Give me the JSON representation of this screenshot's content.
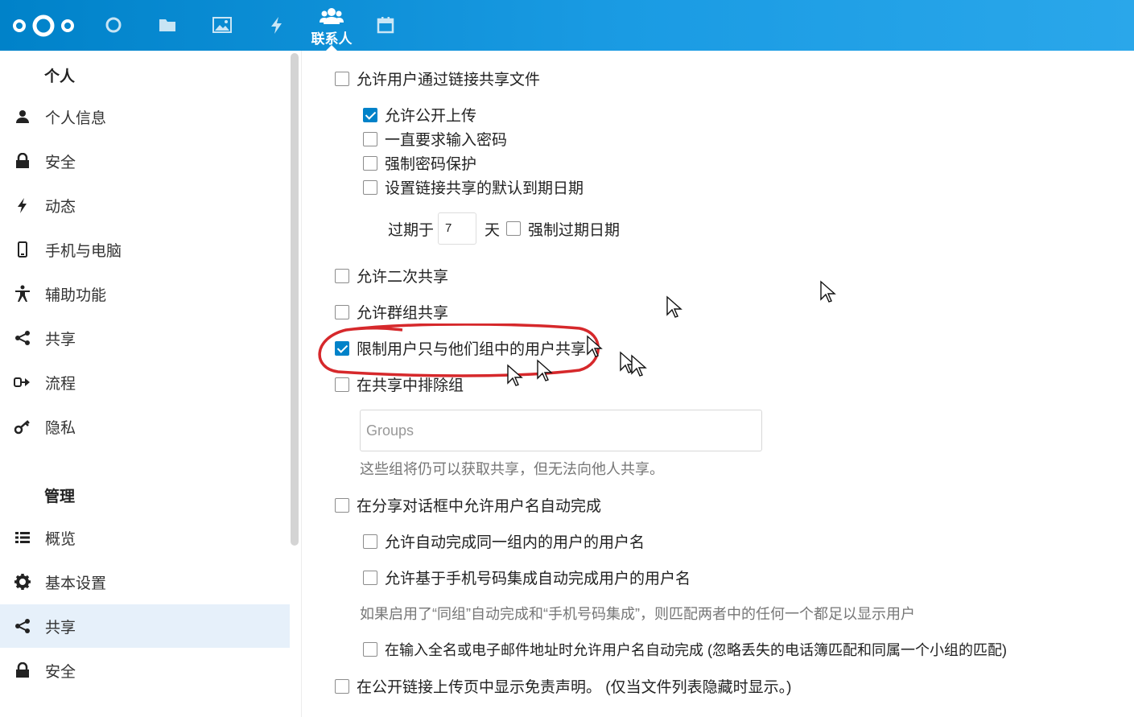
{
  "header": {
    "active_app_label": "联系人",
    "apps": [
      "logo-icon",
      "dashboard-icon",
      "files-icon",
      "photos-icon",
      "activity-icon",
      "contacts-icon",
      "calendar-icon"
    ]
  },
  "sidebar": {
    "personal_heading": "个人",
    "personal_items": [
      {
        "label": "个人信息",
        "icon": "user-icon"
      },
      {
        "label": "安全",
        "icon": "lock-icon"
      },
      {
        "label": "动态",
        "icon": "activity-icon"
      },
      {
        "label": "手机与电脑",
        "icon": "phone-icon"
      },
      {
        "label": "辅助功能",
        "icon": "accessibility-icon"
      },
      {
        "label": "共享",
        "icon": "share-icon"
      },
      {
        "label": "流程",
        "icon": "flow-icon"
      },
      {
        "label": "隐私",
        "icon": "key-icon"
      }
    ],
    "admin_heading": "管理",
    "admin_items": [
      {
        "label": "概览",
        "icon": "list-icon"
      },
      {
        "label": "基本设置",
        "icon": "gear-icon"
      },
      {
        "label": "共享",
        "icon": "share-icon",
        "active": true
      },
      {
        "label": "安全",
        "icon": "lock-icon"
      }
    ]
  },
  "settings": {
    "allow_link_share": {
      "label": "允许用户通过链接共享文件",
      "checked": false
    },
    "allow_public_upload": {
      "label": "允许公开上传",
      "checked": true
    },
    "always_ask_password": {
      "label": "一直要求输入密码",
      "checked": false
    },
    "enforce_password": {
      "label": "强制密码保护",
      "checked": false
    },
    "default_expire": {
      "label": "设置链接共享的默认到期日期",
      "checked": false
    },
    "expire_prefix": "过期于",
    "expire_days": "7",
    "expire_unit": "天",
    "enforce_expire": {
      "label": "强制过期日期",
      "checked": false
    },
    "allow_resharing": {
      "label": "允许二次共享",
      "checked": false
    },
    "allow_group_sharing": {
      "label": "允许群组共享",
      "checked": false
    },
    "restrict_to_group": {
      "label": "限制用户只与他们组中的用户共享",
      "checked": true
    },
    "exclude_groups": {
      "label": "在共享中排除组",
      "checked": false
    },
    "groups_placeholder": "Groups",
    "groups_hint": "这些组将仍可以获取共享，但无法向他人共享。",
    "autocomplete": {
      "label": "在分享对话框中允许用户名自动完成",
      "checked": false
    },
    "autocomplete_group": {
      "label": "允许自动完成同一组内的用户的用户名",
      "checked": false
    },
    "autocomplete_phone": {
      "label": "允许基于手机号码集成自动完成用户的用户名",
      "checked": false
    },
    "autocomplete_hint": "如果启用了“同组”自动完成和“手机号码集成”，则匹配两者中的任何一个都足以显示用户",
    "autocomplete_fullmatch": {
      "label": "在输入全名或电子邮件地址时允许用户名自动完成 (忽略丢失的电话簿匹配和同属一个小组的匹配)",
      "checked": false
    },
    "disclaimer": {
      "label": "在公开链接上传页中显示免责声明。 (仅当文件列表隐藏时显示。)",
      "checked": false
    }
  }
}
